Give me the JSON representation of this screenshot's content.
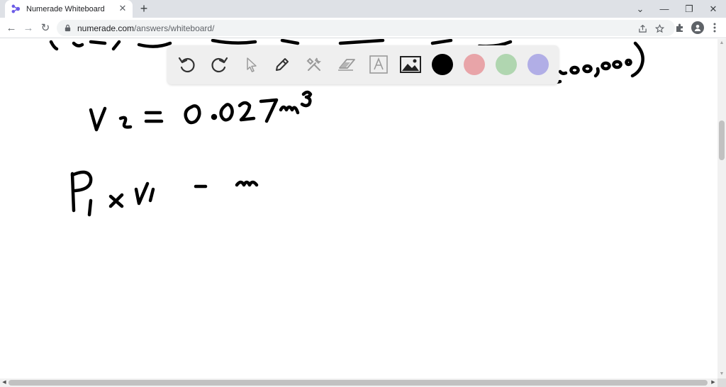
{
  "tab": {
    "title": "Numerade Whiteboard",
    "close_glyph": "✕"
  },
  "newtab_glyph": "+",
  "window": {
    "dropdown_glyph": "⌄",
    "minimize_glyph": "—",
    "restore_glyph": "❐",
    "close_glyph": "✕"
  },
  "nav": {
    "back_glyph": "←",
    "forward_glyph": "→",
    "reload_glyph": "↻"
  },
  "address": {
    "host": "numerade.com",
    "path": "/answers/whiteboard/"
  },
  "whiteboard": {
    "colors": {
      "black": "#000000",
      "red": "#e8a4a8",
      "green": "#b0d6b0",
      "purple": "#b1aee6"
    }
  },
  "accent": {
    "favicon": "#6c5ce7"
  }
}
